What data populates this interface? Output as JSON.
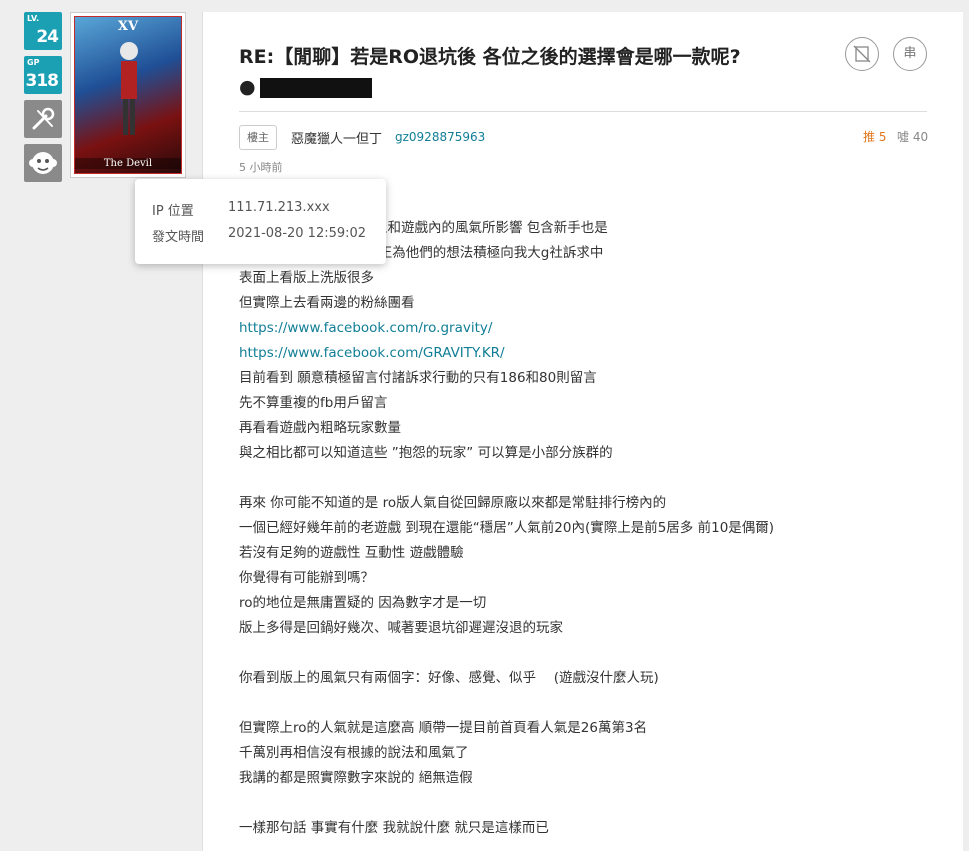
{
  "sidebar": {
    "lv_tag": "LV.",
    "lv_value": "24",
    "gp_tag": "GP",
    "gp_value": "318",
    "tool_icon": "wrench-screwdriver-icon",
    "face_icon": "monkey-face-icon"
  },
  "card": {
    "roman": "XV",
    "caption": "The Devil"
  },
  "post": {
    "title": "RE:【閒聊】若是RO退坑後 各位之後的選擇會是哪一款呢?",
    "title_prefix": "●",
    "delete_icon": "no-entry-icon",
    "chain_label": "串",
    "host_badge": "樓主",
    "author_name": "惡魔獵人一但丁",
    "author_id": "gz0928875963",
    "push_label": "推 5",
    "boo_label": "噓 40",
    "time_ago": "5 小時前",
    "body_lines": [
      "相信很多玩家都會被版上和遊戲內的風氣所影響 包含新手也是",
      "“抱怨的玩家”好了 目前正為他們的想法積極向我大g社訴求中",
      "表面上看版上洗版很多",
      "但實際上去看兩邊的粉絲團看",
      "https://www.facebook.com/ro.gravity/",
      "https://www.facebook.com/GRAVITY.KR/",
      "目前看到 願意積極留言付諸訴求行動的只有186和80則留言",
      "先不算重複的fb用戶留言",
      "再看看遊戲內粗略玩家數量",
      "與之相比都可以知道這些 ”抱怨的玩家” 可以算是小部分族群的",
      "",
      "再來 你可能不知道的是 ro版人氣自從回歸原廠以來都是常駐排行榜內的",
      "一個已經好幾年前的老遊戲 到現在還能“穩居”人氣前20內(實際上是前5居多 前10是偶爾)",
      "若沒有足夠的遊戲性 互動性 遊戲體驗",
      "你覺得有可能辦到嗎？",
      "ro的地位是無庸置疑的 因為數字才是一切",
      "版上多得是回鍋好幾次、喊著要退坑卻遲遲沒退的玩家",
      "",
      "你看到版上的風氣只有兩個字：好像、感覺、似乎　 (遊戲沒什麼人玩)",
      "",
      "但實際上ro的人氣就是這麼高 順帶一提目前首頁看人氣是26萬第3名",
      "千萬別再相信沒有根據的說法和風氣了",
      "我講的都是照實際數字來說的 絕無造假",
      "",
      "一樣那句話 事實有什麼 我就說什麼 就只是這樣而已"
    ],
    "link_indices": [
      4,
      5
    ]
  },
  "tooltip": {
    "ip_label": "IP 位置",
    "ip_value": "111.71.213.xxx",
    "date_label": "發文時間",
    "date_value": "2021-08-20 12:59:02"
  }
}
